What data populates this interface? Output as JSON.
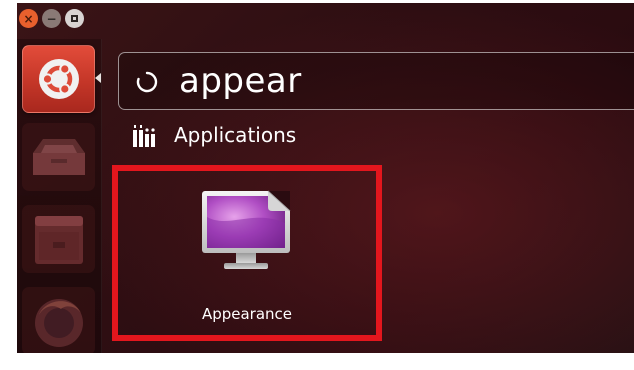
{
  "window_controls": {
    "close": "×",
    "minimize": "−"
  },
  "search": {
    "query": "appear"
  },
  "category": {
    "label": "Applications"
  },
  "results": [
    {
      "label": "Appearance",
      "icon": "appearance-monitor-icon"
    }
  ],
  "colors": {
    "highlight_border": "#e3161d",
    "launcher_home": "#d03a2c",
    "background": "#2e0e12"
  }
}
